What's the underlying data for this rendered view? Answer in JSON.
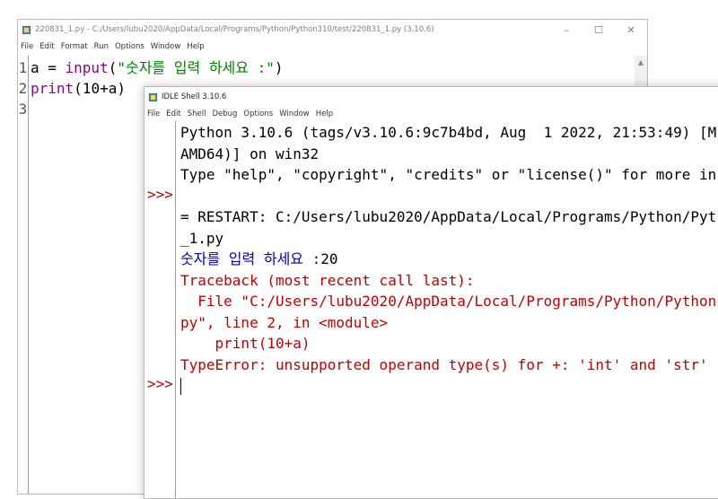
{
  "editor": {
    "title": "220831_1.py - C:/Users/lubu2020/AppData/Local/Programs/Python/Python310/test/220831_1.py (3.10.6)",
    "menu": [
      "File",
      "Edit",
      "Format",
      "Run",
      "Options",
      "Window",
      "Help"
    ],
    "line_numbers": [
      "1",
      "2",
      "3"
    ],
    "lines": [
      {
        "var": "a = ",
        "func": "input",
        "open": "(",
        "string": "\"숫자를 입력 하세요 :\"",
        "close": ")"
      },
      {
        "func": "print",
        "rest": "(10+a)"
      }
    ],
    "controls": {
      "minimize": "–",
      "maximize": "☐",
      "close": "✕"
    }
  },
  "shell": {
    "title": "IDLE Shell 3.10.6",
    "menu": [
      "File",
      "Edit",
      "Shell",
      "Debug",
      "Options",
      "Window",
      "Help"
    ],
    "prompt": ">>>",
    "output": {
      "line1": "Python 3.10.6 (tags/v3.10.6:9c7b4bd, Aug  1 2022, 21:53:49) [M",
      "line2": "AMD64)] on win32",
      "line3": "Type \"help\", \"copyright\", \"credits\" or \"license()\" for more in",
      "restart1": "= RESTART: C:/Users/lubu2020/AppData/Local/Programs/Python/Pyt",
      "restart2": "_1.py",
      "input_prompt": "숫자를 입력 하세요 :",
      "input_value": "20",
      "tb1": "Traceback (most recent call last):",
      "tb2": "  File \"C:/Users/lubu2020/AppData/Local/Programs/Python/Python",
      "tb3": "py\", line 2, in <module>",
      "tb4": "    print(10+a)",
      "tb5": "TypeError: unsupported operand type(s) for +: 'int' and 'str'"
    }
  }
}
